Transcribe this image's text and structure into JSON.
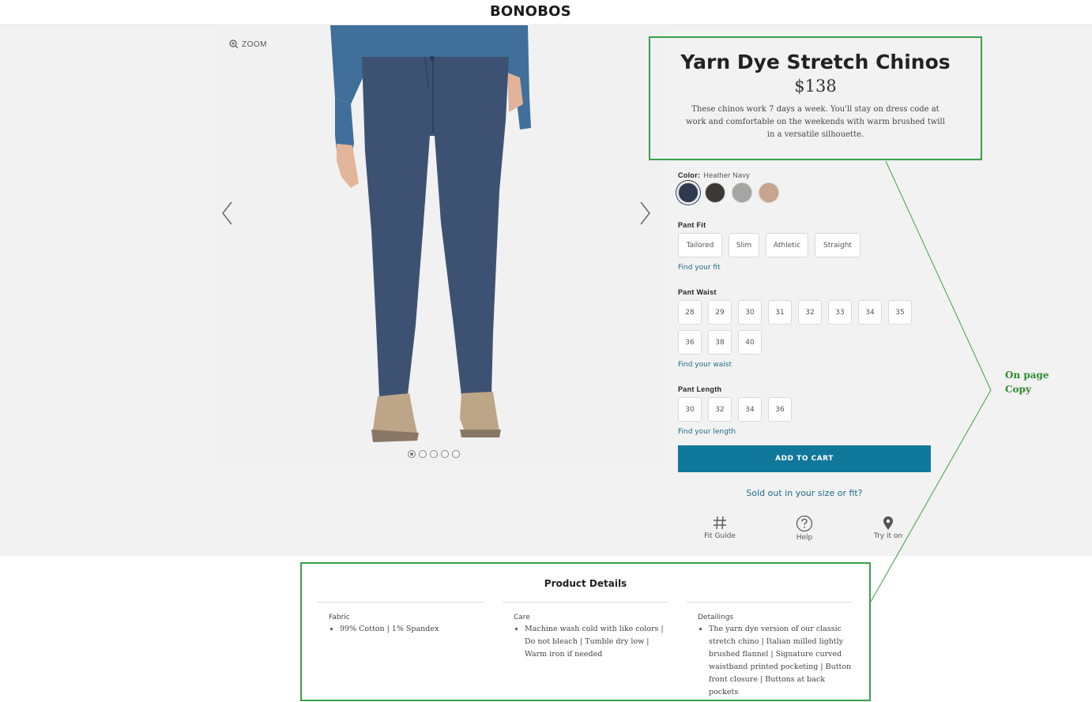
{
  "header": {
    "logo": "BONOBOS"
  },
  "gallery": {
    "zoom_label": "ZOOM",
    "dot_count": 5,
    "active_dot": 1
  },
  "product": {
    "title": "Yarn Dye Stretch Chinos",
    "price": "$138",
    "description": "These chinos work 7 days a week. You'll stay on dress code at work and comfortable on the weekends with warm brushed twill in a versatile silhouette."
  },
  "color": {
    "label": "Color:",
    "selected": "Heather Navy",
    "swatches": [
      {
        "name": "heather-navy",
        "hex": "#2d3a4f",
        "selected": true
      },
      {
        "name": "charcoal",
        "hex": "#3b3838",
        "selected": false
      },
      {
        "name": "grey",
        "hex": "#a5a5a2",
        "selected": false
      },
      {
        "name": "khaki",
        "hex": "#c6a58c",
        "selected": false
      }
    ]
  },
  "fit": {
    "label": "Pant Fit",
    "options": [
      "Tailored",
      "Slim",
      "Athletic",
      "Straight"
    ],
    "link": "Find your fit"
  },
  "waist": {
    "label": "Pant Waist",
    "options_row1": [
      "28",
      "29",
      "30",
      "31",
      "32",
      "33",
      "34",
      "35"
    ],
    "options_row2": [
      "36",
      "38",
      "40"
    ],
    "link": "Find your waist"
  },
  "length": {
    "label": "Pant Length",
    "options": [
      "30",
      "32",
      "34",
      "36"
    ],
    "link": "Find your length"
  },
  "cta": {
    "add_to_cart": "ADD TO CART",
    "sold_out": "Sold out in your size or fit?"
  },
  "utilities": {
    "fit_guide": "Fit Guide",
    "help": "Help",
    "try_it_on": "Try it on"
  },
  "annotation": {
    "line1": "On page",
    "line2": "Copy"
  },
  "details": {
    "title": "Product Details",
    "fabric": {
      "heading": "Fabric",
      "items": [
        "99% Cotton | 1% Spandex"
      ]
    },
    "care": {
      "heading": "Care",
      "items": [
        "Machine wash cold with like colors | Do not bleach | Tumble dry low | Warm iron if needed"
      ]
    },
    "detailings": {
      "heading": "Detailings",
      "items": [
        "The yarn dye version of our classic stretch chino | Italian milled lightly brushed flannel | Signature curved waistband printed pocketing | Button front closure | Buttons at back pockets"
      ]
    }
  },
  "colors": {
    "brand_teal": "#10789a",
    "link_blue": "#1f6b8a",
    "annotation_green": "#3aa14a"
  }
}
